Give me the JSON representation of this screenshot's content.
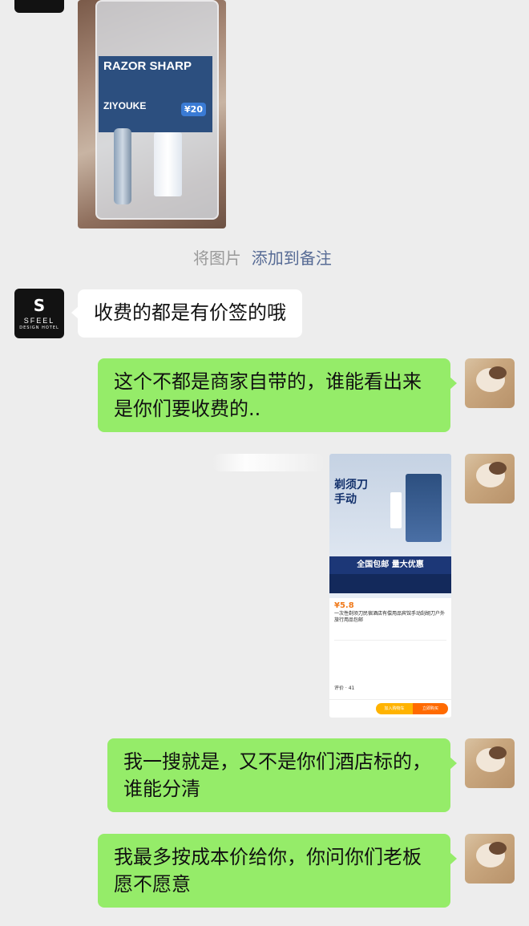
{
  "chat": {
    "system_notice": {
      "prefix": "将图片",
      "link": "添加到备注"
    },
    "messages": [
      {
        "side": "left",
        "text": "收费的都是有价签的哦"
      },
      {
        "side": "right",
        "text": "这个不都是商家自带的，谁能看出来是你们要收费的.."
      },
      {
        "side": "right",
        "text": "我一搜就是，又不是你们酒店标的，谁能分清"
      },
      {
        "side": "right",
        "text": "我最多按成本价给你，你问你们老板愿不愿意"
      }
    ]
  },
  "hotel_avatar": {
    "brand": "SFEEL",
    "sub": "DESIGN HOTEL",
    "mark": "S"
  },
  "razor_photo": {
    "brand": "RAZOR SHARP",
    "maker": "ZIYOUKE",
    "price_tag": "¥20"
  },
  "product_card": {
    "headline": "剃须刀 手动",
    "banner": "全国包邮 量大优惠",
    "price": "¥5.8",
    "title": "一次性剃须刀民宿酒店有偿用品宾馆手动刮胡刀户外旅行用品包邮",
    "review_label": "评价 · 41",
    "cart_button": "加入购物车",
    "buy_button": "立即购买"
  },
  "colors": {
    "my_bubble": "#95ec69",
    "their_bubble": "#ffffff",
    "background": "#ededed",
    "link": "#576b95"
  }
}
